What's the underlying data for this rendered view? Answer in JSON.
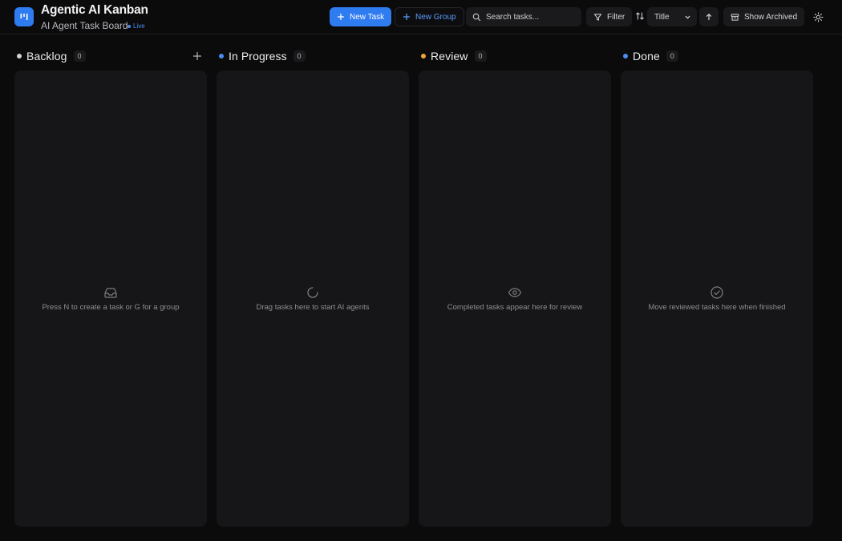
{
  "app": {
    "title": "Agentic AI Kanban",
    "subtitle": "AI Agent Task Board",
    "live_label": "Live",
    "accent": "#2f7bf0"
  },
  "toolbar": {
    "new_task_label": "New Task",
    "new_group_label": "New Group",
    "search_placeholder": "Search tasks...",
    "filter_label": "Filter",
    "sort_selected": "Title",
    "show_archived_label": "Show Archived",
    "icons": [
      "plus-icon",
      "search-icon",
      "filter-icon",
      "sort-icon",
      "chevron-down-icon",
      "arrow-up-icon",
      "archive-icon",
      "sun-icon"
    ]
  },
  "columns": [
    {
      "title": "Backlog",
      "count": "0",
      "dot_color": "#d4d4d8",
      "empty_icon": "inbox-icon",
      "empty_text": "Press N to create a task or G for a group"
    },
    {
      "title": "In Progress",
      "count": "0",
      "dot_color": "#4a8cf0",
      "empty_icon": "loader-icon",
      "empty_text": "Drag tasks here to start AI agents"
    },
    {
      "title": "Review",
      "count": "0",
      "dot_color": "#f2a33a",
      "empty_icon": "eye-icon",
      "empty_text": "Completed tasks appear here for review"
    },
    {
      "title": "Done",
      "count": "0",
      "dot_color": "#4a8cf0",
      "empty_icon": "check-circle-icon",
      "empty_text": "Move reviewed tasks here when finished"
    }
  ]
}
